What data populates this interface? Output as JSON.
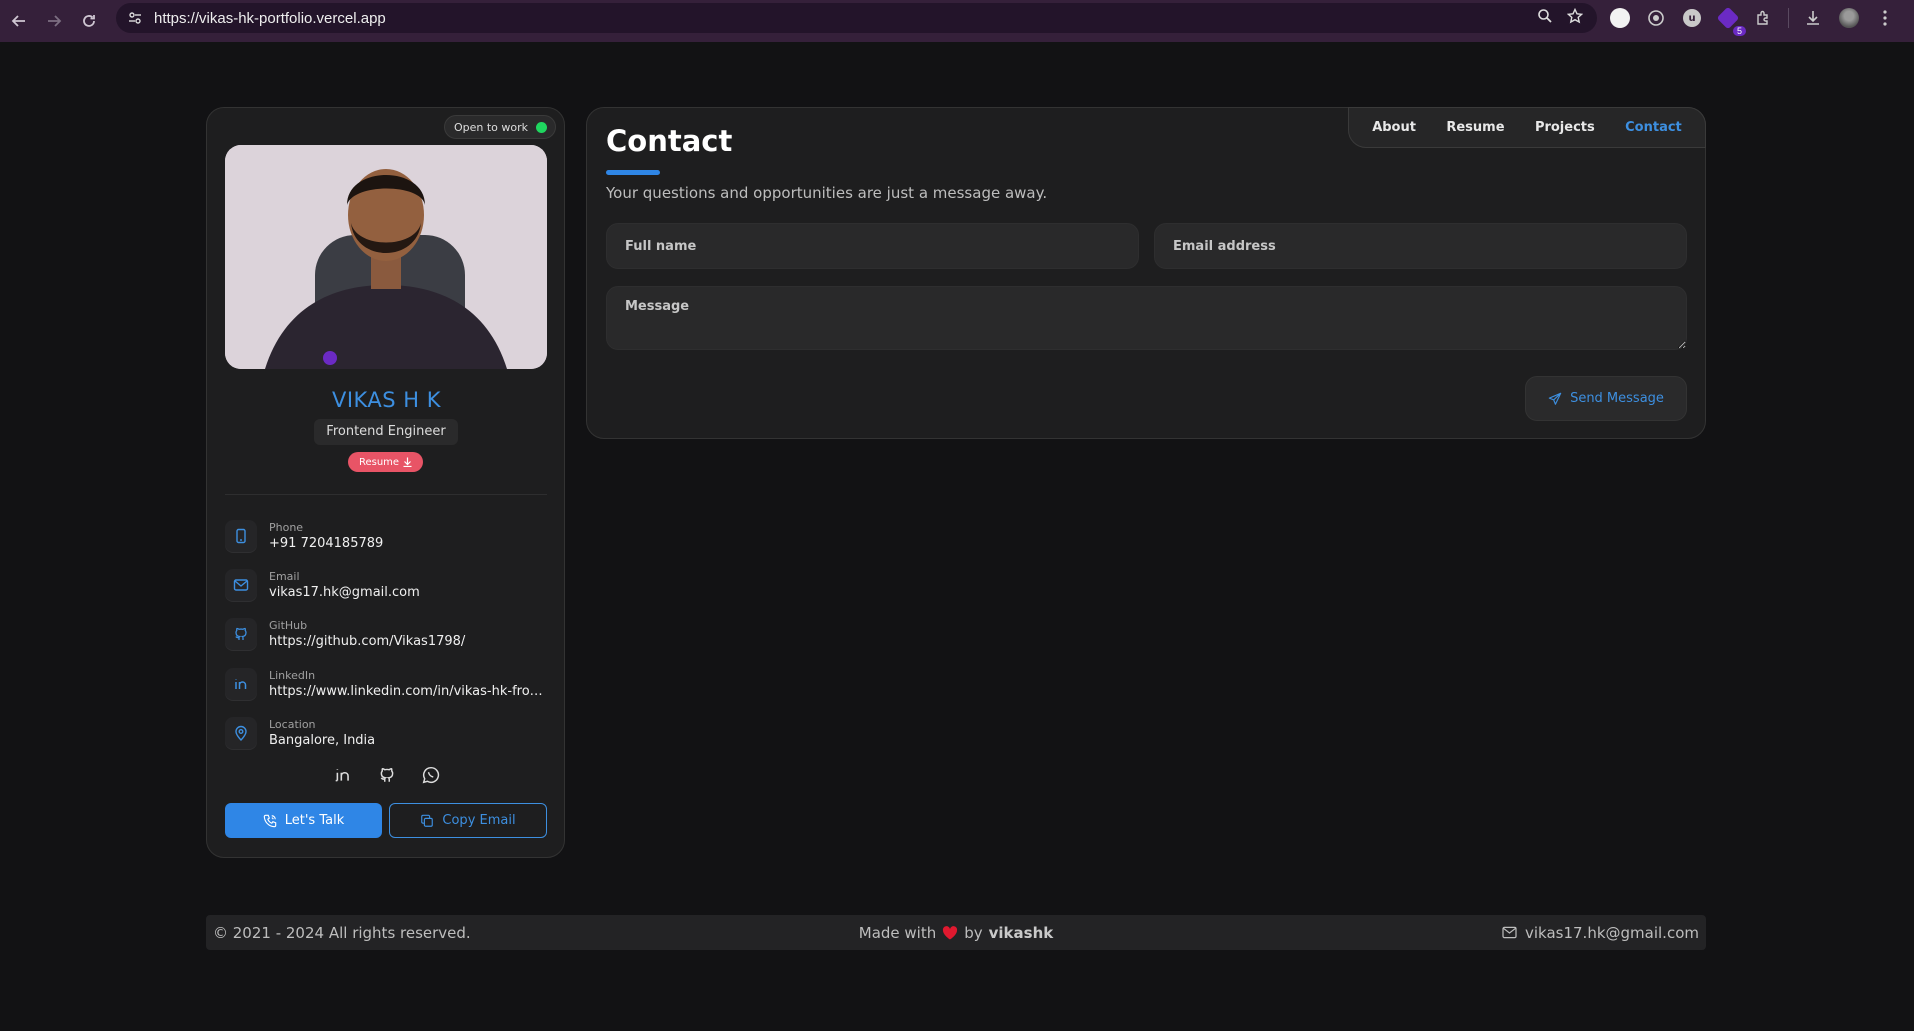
{
  "browser": {
    "url": "https://vikas-hk-portfolio.vercel.app",
    "extension_badge": "5"
  },
  "sidebar": {
    "status": "Open to work",
    "name": "VIKAS H K",
    "role": "Frontend Engineer",
    "resume_label": "Resume",
    "contacts": [
      {
        "label": "Phone",
        "value": "+91 7204185789",
        "icon": "phone-icon"
      },
      {
        "label": "Email",
        "value": "vikas17.hk@gmail.com",
        "icon": "mail-icon"
      },
      {
        "label": "GitHub",
        "value": "https://github.com/Vikas1798/",
        "icon": "github-icon"
      },
      {
        "label": "LinkedIn",
        "value": "https://www.linkedin.com/in/vikas-hk-frontend",
        "icon": "linkedin-icon"
      },
      {
        "label": "Location",
        "value": "Bangalore, India",
        "icon": "location-pin-icon"
      }
    ],
    "talk_label": "Let's Talk",
    "copy_label": "Copy Email"
  },
  "main": {
    "tabs": [
      {
        "label": "About"
      },
      {
        "label": "Resume"
      },
      {
        "label": "Projects"
      },
      {
        "label": "Contact"
      }
    ],
    "active_tab": "Contact",
    "title": "Contact",
    "subtitle": "Your questions and opportunities are just a message away.",
    "form": {
      "name_placeholder": "Full name",
      "email_placeholder": "Email address",
      "message_placeholder": "Message",
      "send_label": "Send Message"
    }
  },
  "footer": {
    "copyright": "© 2021 - 2024 All rights reserved.",
    "made_with": "Made with",
    "by": "by",
    "author": "vikashk",
    "email": "vikas17.hk@gmail.com"
  },
  "colors": {
    "accent": "#2f86e6",
    "status_green": "#1fd65f",
    "resume_chip": "#e85466"
  }
}
